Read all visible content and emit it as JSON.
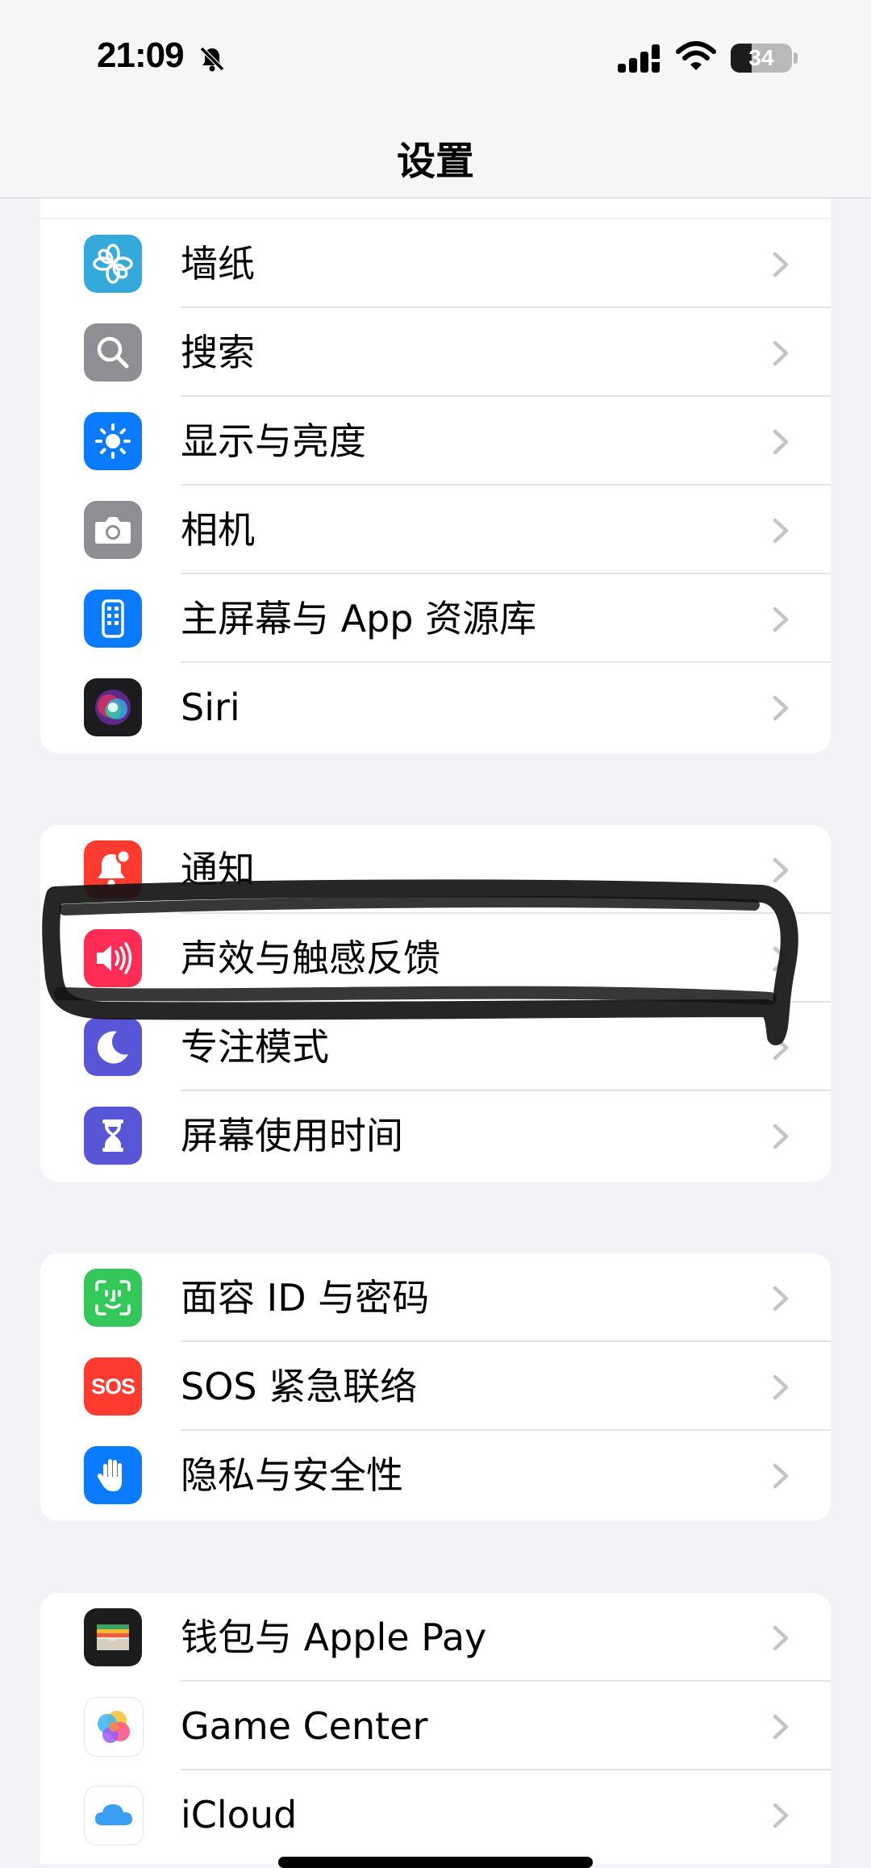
{
  "status_bar": {
    "time": "21:09",
    "battery_percent": "34",
    "battery_level": 0.34
  },
  "nav": {
    "title": "设置"
  },
  "groups": [
    {
      "items": [
        {
          "label": "墙纸",
          "icon": "wallpaper-icon",
          "color": "#34aadc"
        },
        {
          "label": "搜索",
          "icon": "search-icon",
          "color": "#8e8e93"
        },
        {
          "label": "显示与亮度",
          "icon": "brightness-icon",
          "color": "#0a7aff"
        },
        {
          "label": "相机",
          "icon": "camera-icon",
          "color": "#8e8e93"
        },
        {
          "label": "主屏幕与 App 资源库",
          "icon": "home-screen-icon",
          "color": "#0a7aff"
        },
        {
          "label": "Siri",
          "icon": "siri-icon",
          "color": "#1c1c1e"
        }
      ]
    },
    {
      "items": [
        {
          "label": "通知",
          "icon": "notifications-icon",
          "color": "#ff3b30"
        },
        {
          "label": "声效与触感反馈",
          "icon": "sound-icon",
          "color": "#ff2d55"
        },
        {
          "label": "专注模式",
          "icon": "focus-moon-icon",
          "color": "#5856d6"
        },
        {
          "label": "屏幕使用时间",
          "icon": "hourglass-icon",
          "color": "#5856d6"
        }
      ]
    },
    {
      "items": [
        {
          "label": "面容 ID 与密码",
          "icon": "face-id-icon",
          "color": "#34c759"
        },
        {
          "label": "SOS 紧急联络",
          "icon": "sos-icon",
          "color": "#ff3b30",
          "icon_text": "SOS"
        },
        {
          "label": "隐私与安全性",
          "icon": "hand-privacy-icon",
          "color": "#0a7aff"
        }
      ]
    },
    {
      "items": [
        {
          "label": "钱包与 Apple Pay",
          "icon": "wallet-icon",
          "color": "#1c1c1e"
        },
        {
          "label": "Game Center",
          "icon": "game-center-icon",
          "color": "#ffffff"
        },
        {
          "label": "iCloud",
          "icon": "icloud-icon",
          "color": "#ffffff"
        }
      ]
    }
  ]
}
